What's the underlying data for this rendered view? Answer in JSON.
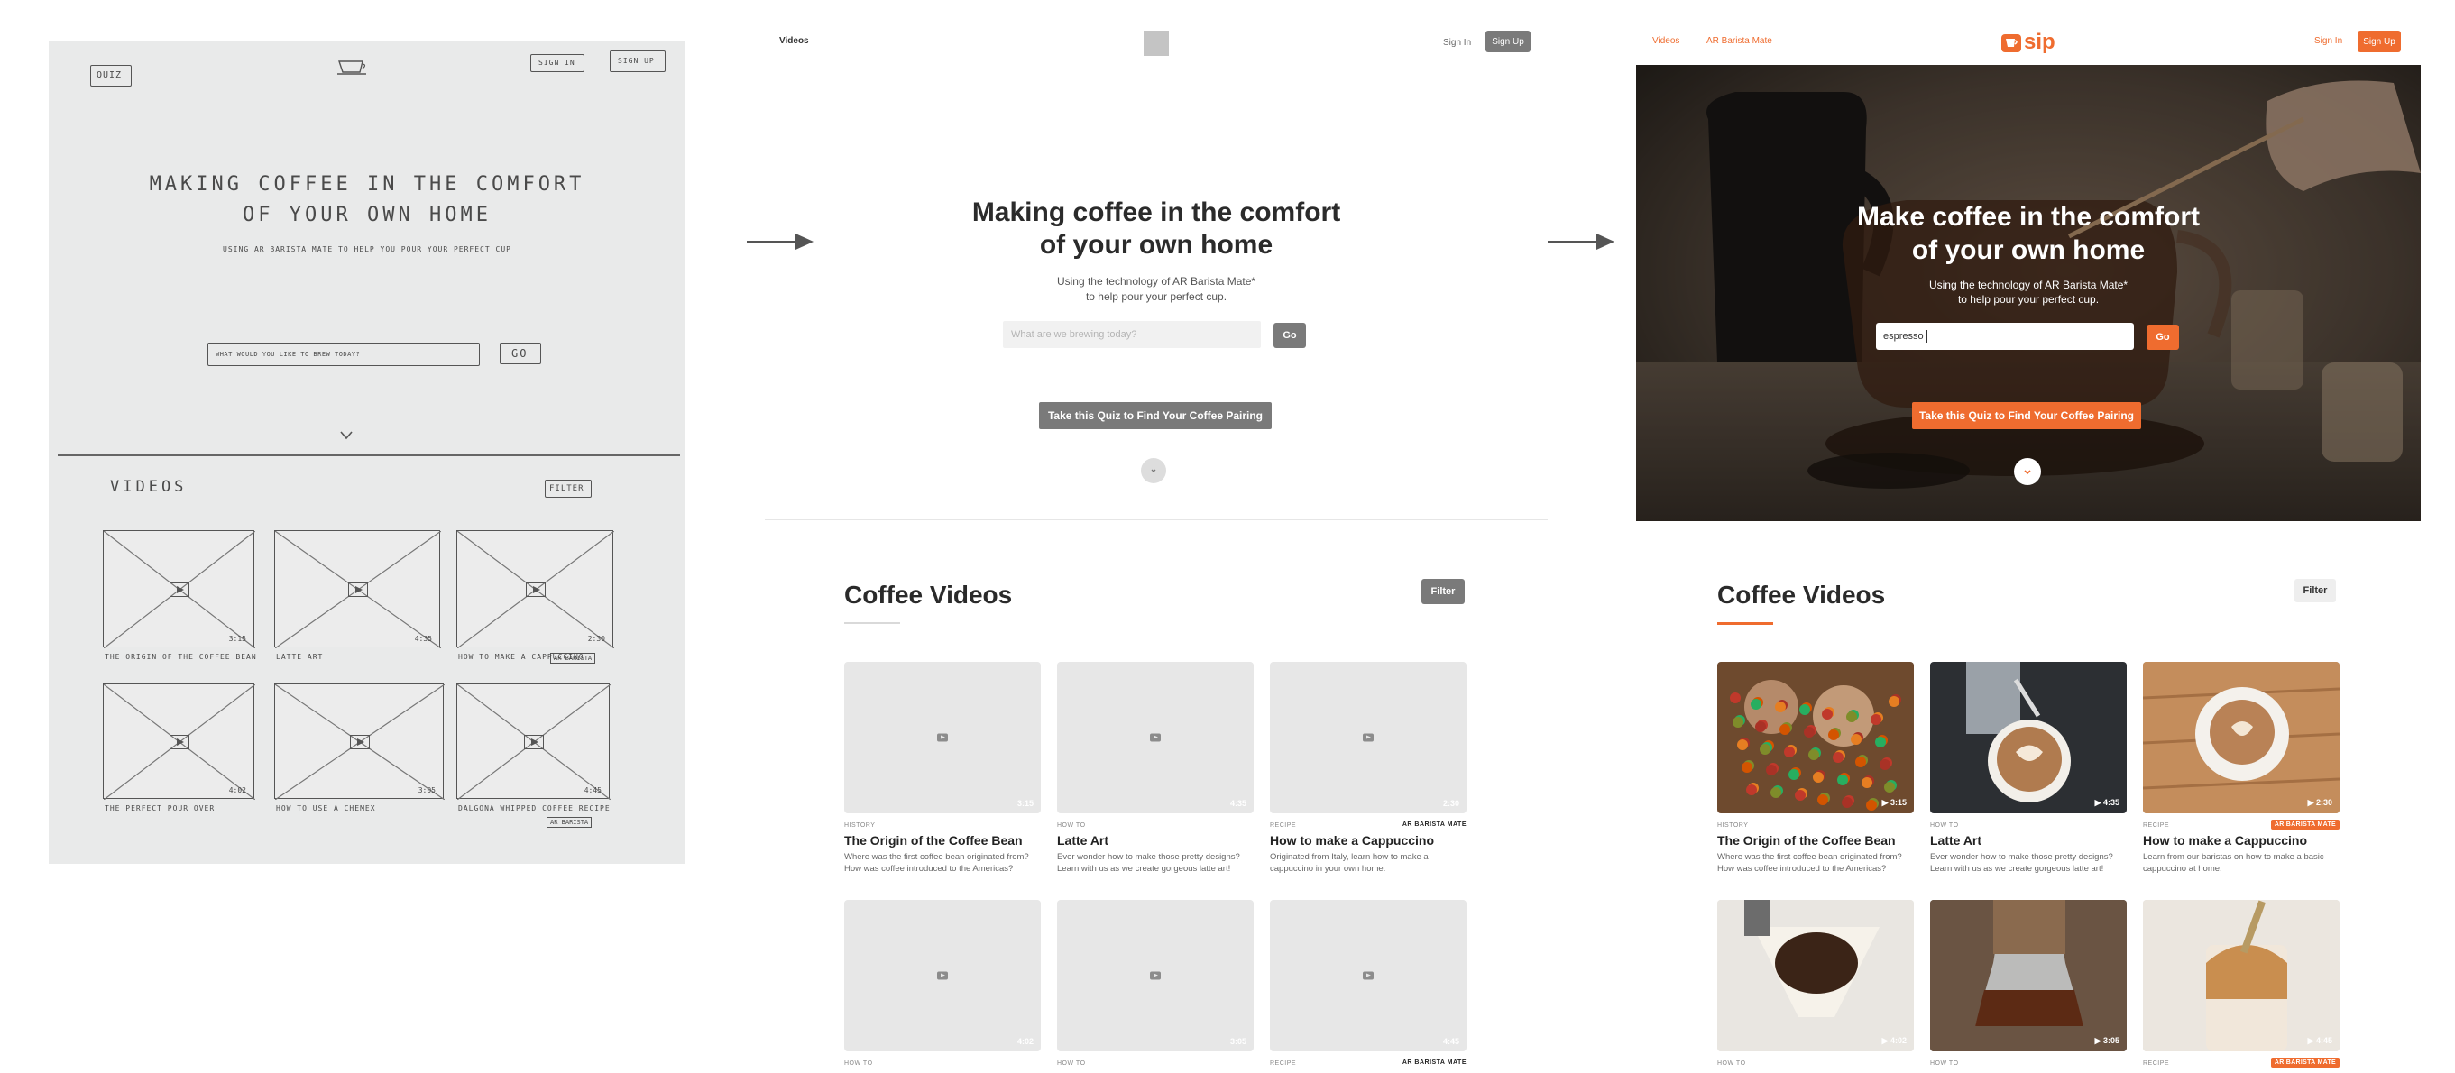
{
  "sketch": {
    "nav_quiz": "QUIZ",
    "nav_signin": "SIGN IN",
    "nav_signup": "SIGN UP",
    "hero_line1": "MAKING COFFEE IN THE COMFORT",
    "hero_line2": "OF YOUR OWN HOME",
    "hero_sub": "USING AR BARISTA MATE TO HELP YOU POUR YOUR PERFECT CUP",
    "search_placeholder": "WHAT WOULD YOU LIKE TO BREW TODAY?",
    "go": "GO",
    "section_title": "VIDEOS",
    "filter": "FILTER",
    "cards": [
      {
        "caption": "THE ORIGIN OF THE COFFEE BEAN",
        "duration": "3:15",
        "tag": ""
      },
      {
        "caption": "LATTE ART",
        "duration": "4:35",
        "tag": ""
      },
      {
        "caption": "HOW TO MAKE A CAPPUCCINO",
        "duration": "2:30",
        "tag": "AR BARISTA"
      },
      {
        "caption": "THE PERFECT POUR OVER",
        "duration": "4:02",
        "tag": ""
      },
      {
        "caption": "HOW TO USE A CHEMEX",
        "duration": "3:05",
        "tag": ""
      },
      {
        "caption": "DALGONA WHIPPED COFFEE RECIPE",
        "duration": "4:45",
        "tag": "AR BARISTA"
      }
    ]
  },
  "wireframe": {
    "nav_videos": "Videos",
    "nav_signin": "Sign In",
    "nav_signup": "Sign Up",
    "hero_line1": "Making coffee in the comfort",
    "hero_line2": "of your own home",
    "sub_line1": "Using the technology of AR Barista Mate*",
    "sub_line2": "to help pour your perfect cup.",
    "search_placeholder": "What are we brewing today?",
    "go": "Go",
    "quiz_button": "Take this Quiz to Find Your Coffee Pairing",
    "section_title": "Coffee Videos",
    "filter": "Filter",
    "cards": [
      {
        "category": "HISTORY",
        "title": "The Origin of the Coffee Bean",
        "desc": "Where was the first coffee bean originated from? How was coffee introduced to the Americas?",
        "duration": "3:15",
        "badge": ""
      },
      {
        "category": "HOW TO",
        "title": "Latte Art",
        "desc": "Ever wonder how to make those pretty designs? Learn with us as we create gorgeous latte art!",
        "duration": "4:35",
        "badge": ""
      },
      {
        "category": "RECIPE",
        "title": "How to make a Cappuccino",
        "desc": "Originated from Italy, learn how to make a cappuccino in your own home.",
        "duration": "2:30",
        "badge": "AR BARISTA MATE"
      },
      {
        "category": "HOW TO",
        "title": "",
        "desc": "",
        "duration": "4:02",
        "badge": ""
      },
      {
        "category": "HOW TO",
        "title": "",
        "desc": "",
        "duration": "3:05",
        "badge": ""
      },
      {
        "category": "RECIPE",
        "title": "",
        "desc": "",
        "duration": "4:45",
        "badge": "AR BARISTA MATE"
      }
    ]
  },
  "final": {
    "nav_videos": "Videos",
    "nav_ar": "AR Barista Mate",
    "logo": "sip",
    "nav_signin": "Sign In",
    "nav_signup": "Sign Up",
    "hero_line1": "Make coffee in the comfort",
    "hero_line2": "of your own home",
    "sub_line1": "Using the technology of AR Barista Mate*",
    "sub_line2": "to help pour your perfect cup.",
    "search_value": "espresso",
    "go": "Go",
    "quiz_button": "Take this Quiz to Find Your Coffee Pairing",
    "section_title": "Coffee Videos",
    "filter": "Filter",
    "accent_color": "#ef6c2f",
    "cards": [
      {
        "category": "HISTORY",
        "title": "The Origin of the Coffee Bean",
        "desc": "Where was the first coffee bean originated from? How was coffee introduced to the Americas?",
        "duration": "3:15",
        "badge": ""
      },
      {
        "category": "HOW TO",
        "title": "Latte Art",
        "desc": "Ever wonder how to make those pretty designs? Learn with us as we create gorgeous latte art!",
        "duration": "4:35",
        "badge": ""
      },
      {
        "category": "RECIPE",
        "title": "How to make a Cappuccino",
        "desc": "Learn from our baristas on how to make a basic cappuccino at home.",
        "duration": "2:30",
        "badge": "AR BARISTA MATE"
      },
      {
        "category": "HOW TO",
        "title": "",
        "desc": "",
        "duration": "4:02",
        "badge": ""
      },
      {
        "category": "HOW TO",
        "title": "",
        "desc": "",
        "duration": "3:05",
        "badge": ""
      },
      {
        "category": "RECIPE",
        "title": "",
        "desc": "",
        "duration": "4:45",
        "badge": "AR BARISTA MATE"
      }
    ]
  }
}
